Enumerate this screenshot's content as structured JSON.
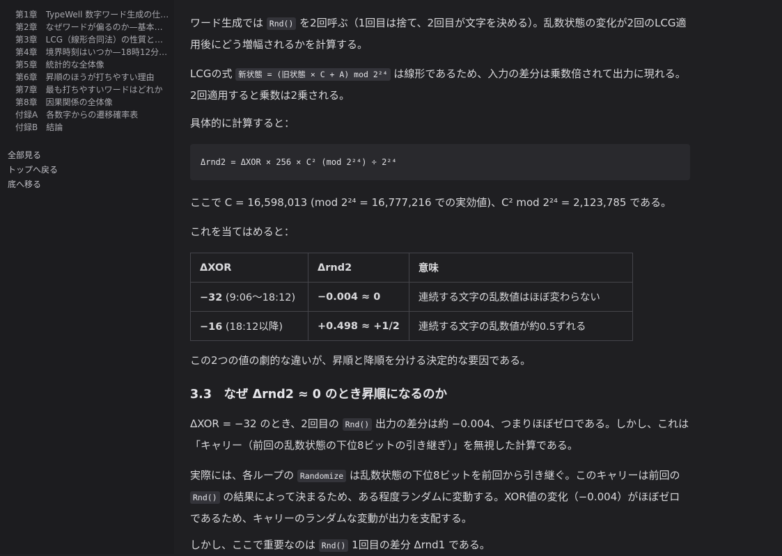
{
  "toc": [
    {
      "num": "第1章",
      "title": "TypeWell 数字ワード生成の仕…"
    },
    {
      "num": "第2章",
      "title": "なぜワードが偏るのか—基本…"
    },
    {
      "num": "第3章",
      "title": "LCG（線形合同法）の性質と…"
    },
    {
      "num": "第4章",
      "title": "境界時刻はいつか—18時12分…"
    },
    {
      "num": "第5章",
      "title": "統計的な全体像"
    },
    {
      "num": "第6章",
      "title": "昇順のほうが打ちやすい理由"
    },
    {
      "num": "第7章",
      "title": "最も打ちやすいワードはどれか"
    },
    {
      "num": "第8章",
      "title": "因果関係の全体像"
    },
    {
      "num": "付録A",
      "title": "各数字からの遷移確率表"
    },
    {
      "num": "付録B",
      "title": "結論"
    }
  ],
  "side_links": {
    "show_all": "全部見る",
    "back_to_top": "トップへ戻る",
    "go_bottom": "底へ移る"
  },
  "content": {
    "p1_a": "ワード生成では ",
    "p1_code": "Rnd()",
    "p1_b": " を2回呼ぶ（1回目は捨て、2回目が文字を決める）。乱数状態の変化が2回のLCG適用後にどう増幅されるかを計算する。",
    "p2_a": "LCGの式 ",
    "p2_code": "新状態 = (旧状態 × C + A) mod 2²⁴",
    "p2_b": " は線形であるため、入力の差分は乗数倍されて出力に現れる。2回適用すると乗数は2乗される。",
    "p3": "具体的に計算すると：",
    "formula": "Δrnd2 = ΔXOR × 256 × C² (mod 2²⁴) ÷ 2²⁴",
    "p4": "ここで C = 16,598,013 (mod 2²⁴ = 16,777,216 での実効値)、C² mod 2²⁴ = 2,123,785 である。",
    "p5": "これを当てはめると：",
    "p6": "この2つの値の劇的な違いが、昇順と降順を分ける決定的な要因である。",
    "h3": "3.3　なぜ Δrnd2 ≈ 0 のとき昇順になるのか",
    "p7_a": "ΔXOR = −32 のとき、2回目の ",
    "p7_code": "Rnd()",
    "p7_b": " 出力の差分は約 −0.004、つまりほぼゼロである。しかし、これは「キャリー（前回の乱数状態の下位8ビットの引き継ぎ）」を無視した計算である。",
    "p8_a": "実際には、各ループの ",
    "p8_code1": "Randomize",
    "p8_b": " は乱数状態の下位8ビットを前回から引き継ぐ。このキャリーは前回の ",
    "p8_code2": "Rnd()",
    "p8_c": " の結果によって決まるため、ある程度ランダムに変動する。XOR値の変化（−0.004）がほぼゼロであるため、キャリーのランダムな変動が出力を支配する。",
    "p9_a": "しかし、ここで重要なのは ",
    "p9_code": "Rnd()",
    "p9_b": " 1回目の差分 Δrnd1 である。"
  },
  "table": {
    "headers": [
      "ΔXOR",
      "Δrnd2",
      "意味"
    ],
    "rows": [
      {
        "xor_bold": "−32",
        "xor_rest": " (9:06〜18:12)",
        "rnd2": "−0.004 ≈ 0",
        "meaning": "連続する文字の乱数値はほぼ変わらない"
      },
      {
        "xor_bold": "−16",
        "xor_rest": " (18:12以降)",
        "rnd2": "+0.498 ≈ +1/2",
        "meaning": "連続する文字の乱数値が約0.5ずれる"
      }
    ]
  }
}
